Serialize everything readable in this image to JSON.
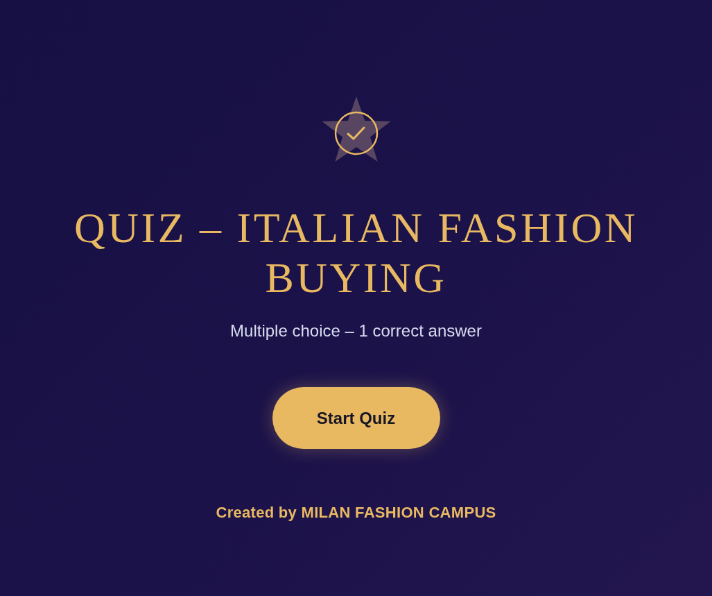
{
  "title": "QUIZ – ITALIAN FASHION BUYING",
  "subtitle": "Multiple choice – 1 correct answer",
  "start_button": {
    "label": "Start Quiz"
  },
  "credit": "Created by MILAN FASHION CAMPUS"
}
